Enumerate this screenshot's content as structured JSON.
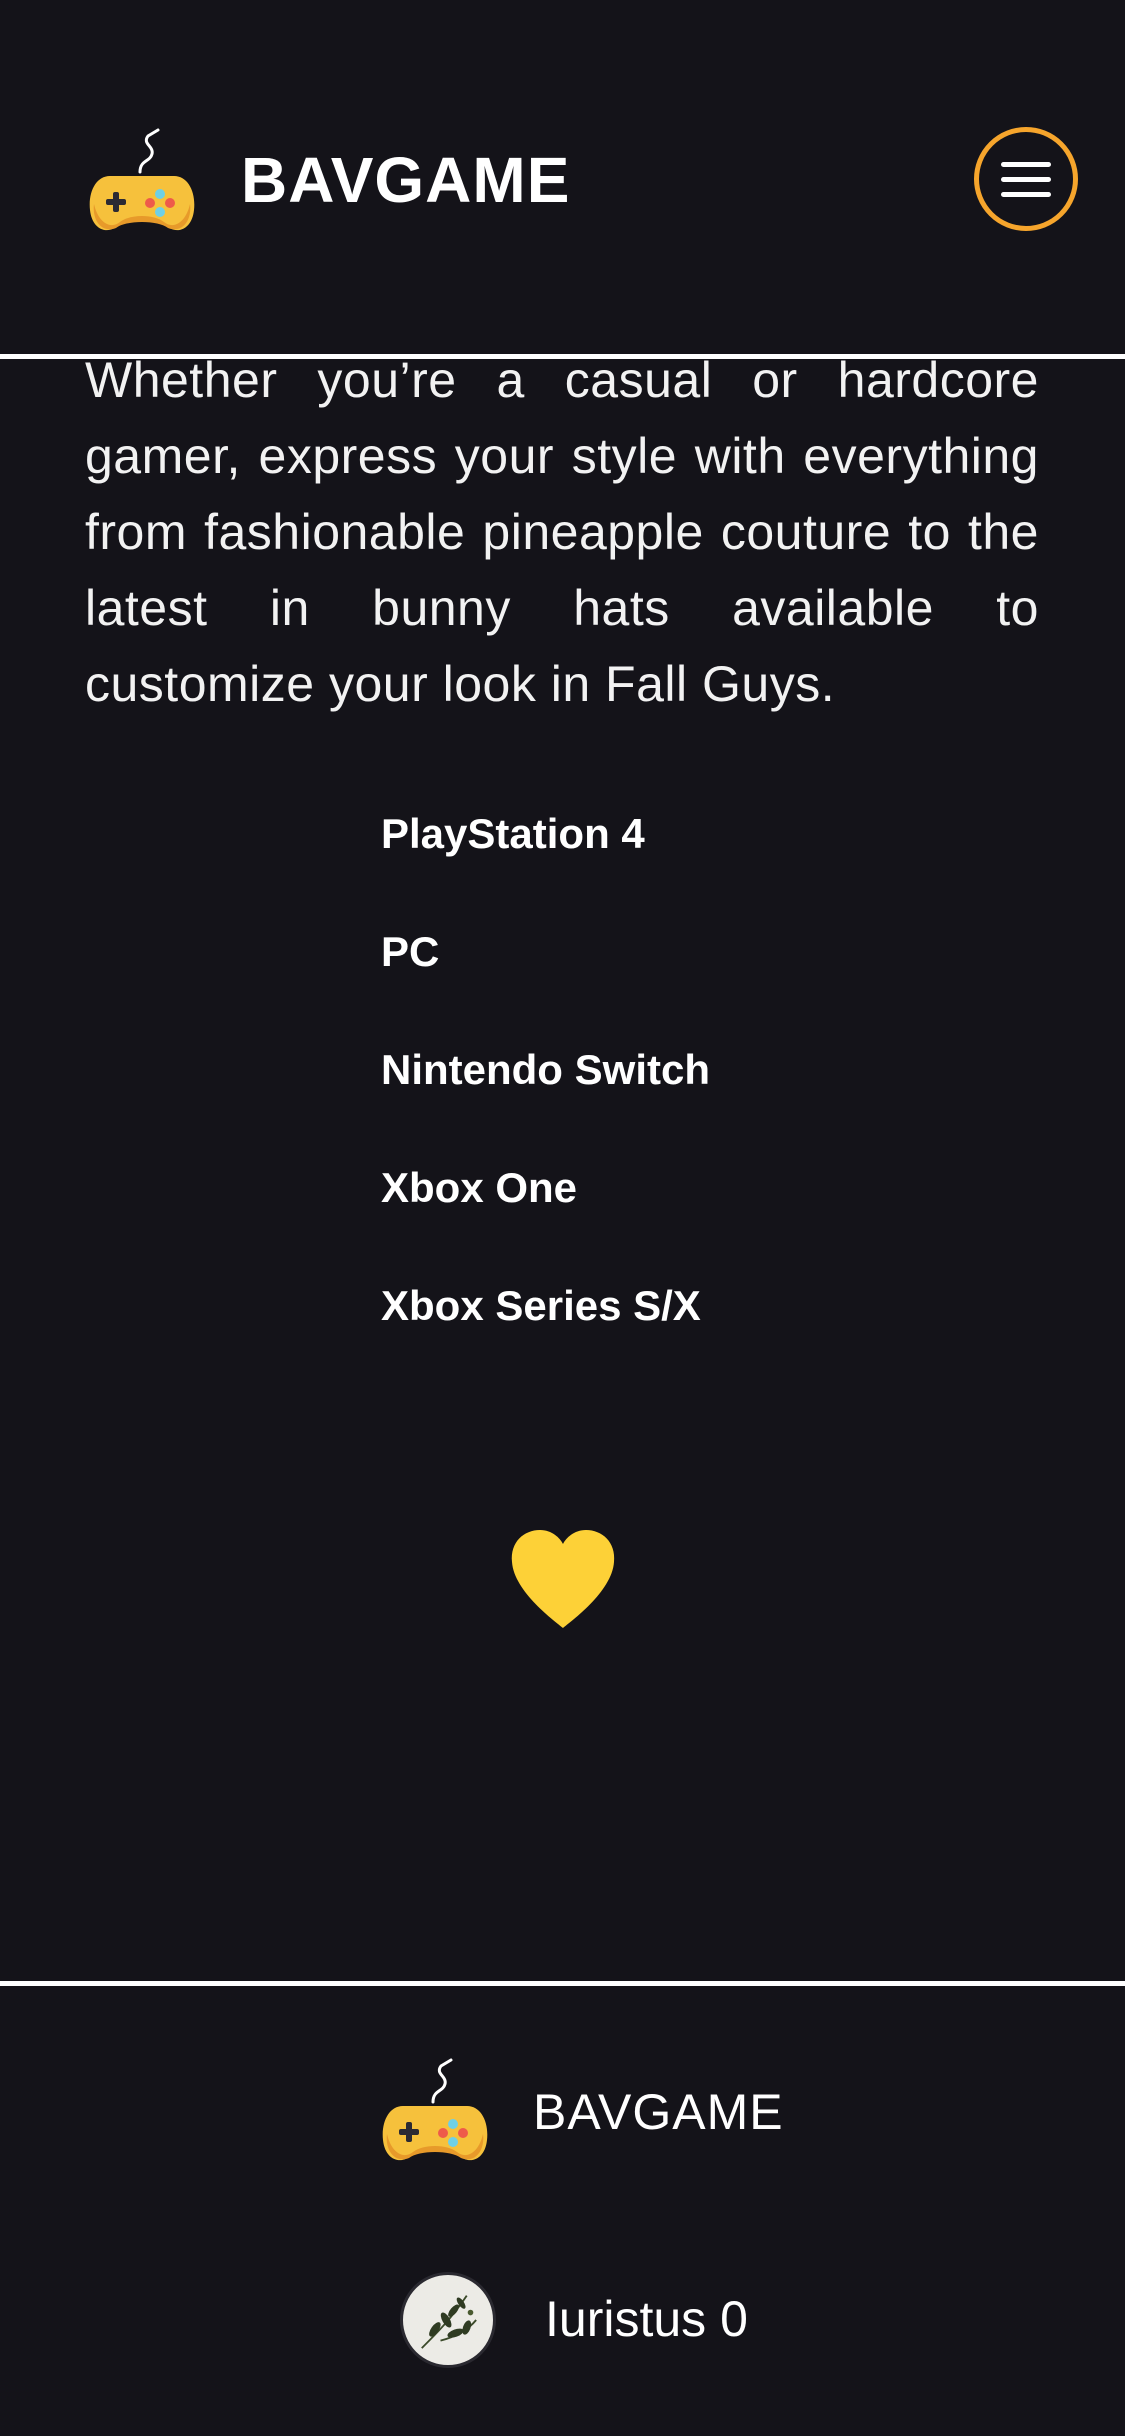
{
  "header": {
    "brand": "BAVGAME",
    "logo_icon": "gamepad-icon",
    "menu_icon": "hamburger-menu-icon"
  },
  "game": {
    "description": "Whether you’re a casual or hardcore gamer, express your style with everything from fashionable pineapple couture to the latest in bunny hats available to customize your look in Fall Guys.",
    "platforms": [
      "PlayStation 4",
      "PC",
      "Nintendo Switch",
      "Xbox One",
      "Xbox Series S/X"
    ],
    "favorite_icon": "heart-icon"
  },
  "footer": {
    "brand": "BAVGAME",
    "logo_icon": "gamepad-icon",
    "user": {
      "name": "Iuristus",
      "count": "0",
      "avatar_icon": "olive-branch-avatar-icon"
    }
  },
  "colors": {
    "background": "#141319",
    "accent": "#f6a52c",
    "heart": "#fdd137",
    "text": "#ffffff"
  }
}
